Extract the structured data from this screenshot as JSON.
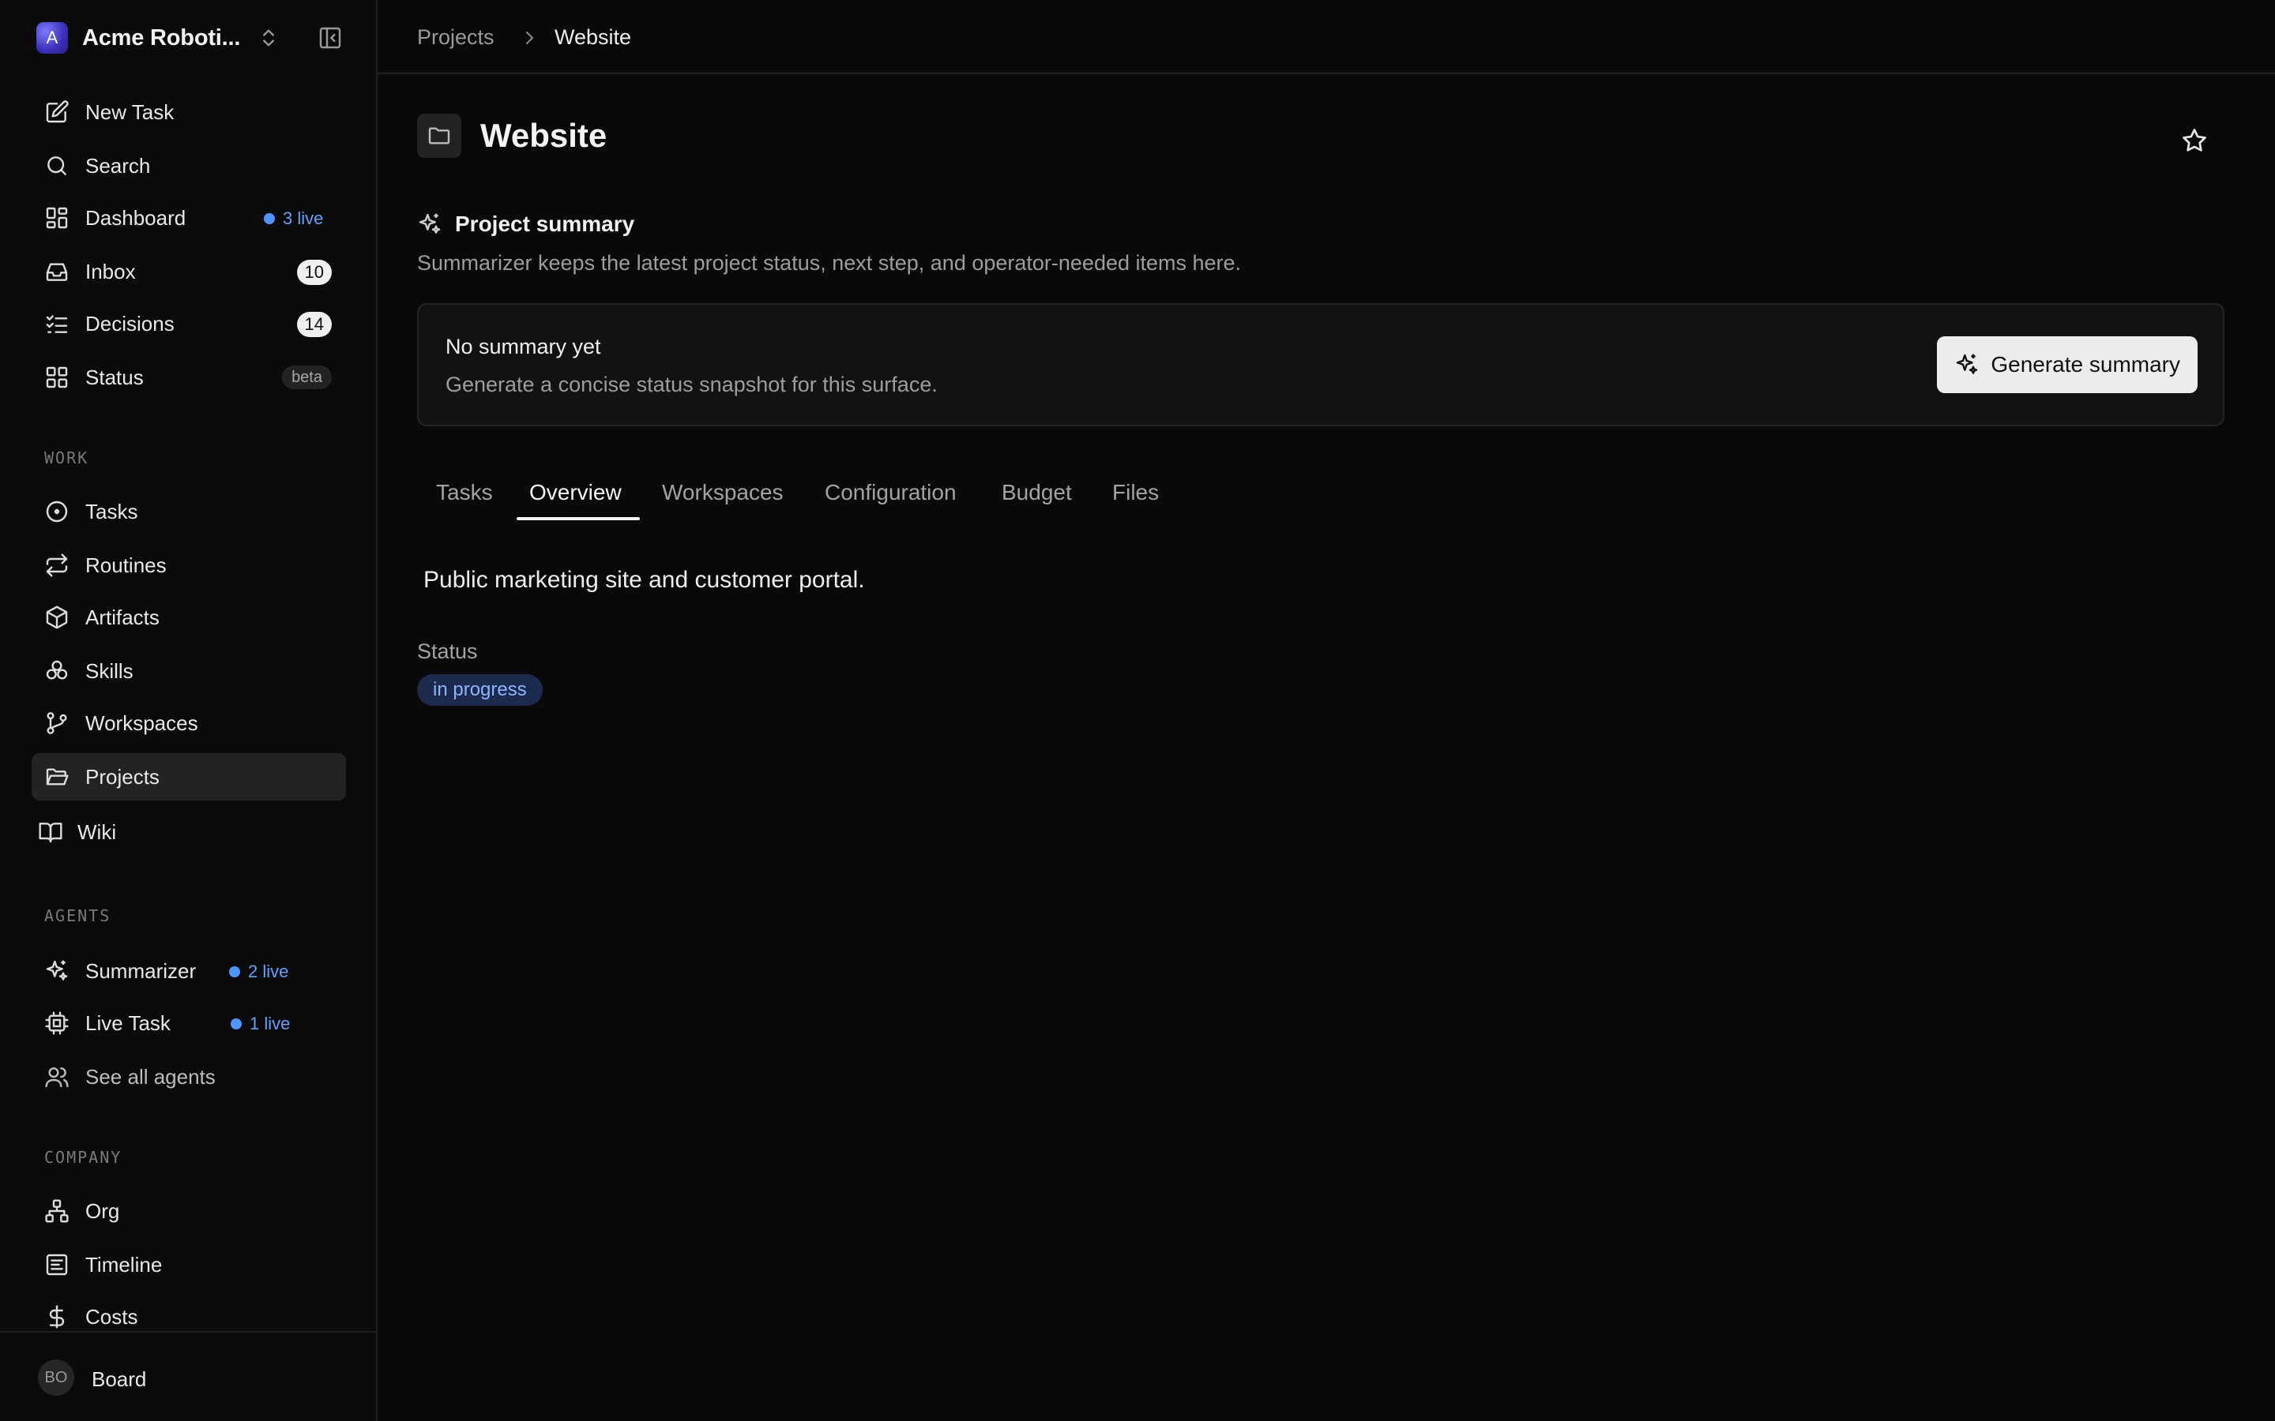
{
  "company": {
    "initial": "A",
    "name": "Acme Roboti..."
  },
  "nav": {
    "new_task": "New Task",
    "search": "Search",
    "dashboard": {
      "label": "Dashboard",
      "live": "3 live"
    },
    "inbox": {
      "label": "Inbox",
      "count": "10"
    },
    "decisions": {
      "label": "Decisions",
      "count": "14"
    },
    "status": {
      "label": "Status",
      "badge": "beta"
    }
  },
  "sections": {
    "work": "WORK",
    "agents": "AGENTS",
    "company": "COMPANY"
  },
  "work": {
    "tasks": "Tasks",
    "routines": "Routines",
    "artifacts": "Artifacts",
    "skills": "Skills",
    "workspaces": "Workspaces",
    "projects": "Projects",
    "wiki": "Wiki"
  },
  "agents": {
    "summarizer": {
      "label": "Summarizer",
      "live": "2 live"
    },
    "live_task": {
      "label": "Live Task",
      "live": "1 live"
    },
    "see_all": "See all agents"
  },
  "company_nav": {
    "org": "Org",
    "timeline": "Timeline",
    "costs": "Costs"
  },
  "user": {
    "initials": "BO",
    "name": "Board"
  },
  "breadcrumb": {
    "parent": "Projects",
    "current": "Website"
  },
  "project": {
    "title": "Website",
    "description": "Public marketing site and customer portal."
  },
  "summary": {
    "title": "Project summary",
    "description": "Summarizer keeps the latest project status, next step, and operator-needed items here.",
    "card_title": "No summary yet",
    "card_description": "Generate a concise status snapshot for this surface.",
    "button": "Generate summary"
  },
  "tabs": [
    "Tasks",
    "Overview",
    "Workspaces",
    "Configuration",
    "Budget",
    "Files"
  ],
  "status": {
    "label": "Status",
    "value": "in progress"
  },
  "colors": {
    "live": "#4f95ff",
    "badge_bg": "#1c2a4d",
    "badge_text": "#8fb4ff",
    "active_nav": "#232323"
  }
}
